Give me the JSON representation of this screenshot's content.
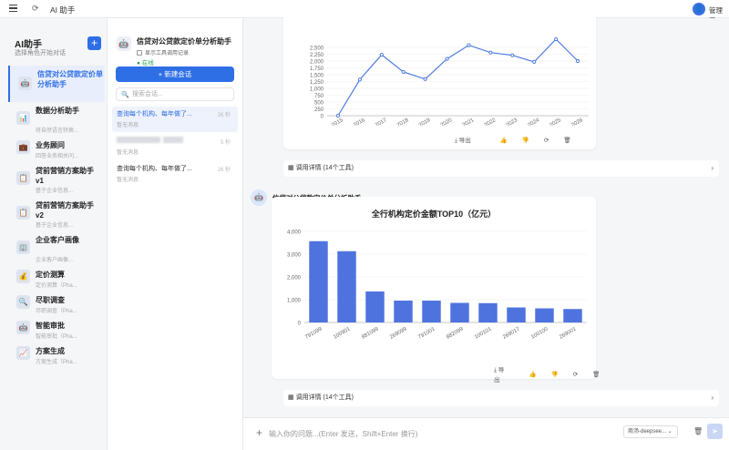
{
  "topbar": {
    "menu": "menu-icon",
    "refresh": "refresh-icon",
    "title": "AI 助手",
    "user": "管理员"
  },
  "sidebar": {
    "title": "AI助手",
    "subtitle": "选择角色开始对话",
    "add": "+",
    "agents": [
      {
        "name": "信贷对公贷款定价单分析助手",
        "desc": "",
        "icon": "robot-icon",
        "active": true
      },
      {
        "name": "数据分析助手",
        "desc": "将自然语言转换...",
        "icon": "chart-icon"
      },
      {
        "name": "业务顾问",
        "desc": "回答业务相关问...",
        "icon": "briefcase-icon"
      },
      {
        "name": "贷前营销方案助手v1",
        "desc": "基于企业信息...",
        "icon": "clipboard-icon"
      },
      {
        "name": "贷前营销方案助手v2",
        "desc": "基于企业信息...",
        "icon": "clipboard-icon"
      },
      {
        "name": "企业客户画像",
        "desc": "企业客户画像...",
        "icon": "building-icon"
      },
      {
        "name": "定价测算",
        "desc": "定价测算（Pha...",
        "icon": "moneybag-icon"
      },
      {
        "name": "尽职调查",
        "desc": "尽职调查（Pha...",
        "icon": "magnifier-icon"
      },
      {
        "name": "智能审批",
        "desc": "智能审批（Pha...",
        "icon": "robot-icon"
      },
      {
        "name": "方案生成",
        "desc": "方案生成（Pha...",
        "icon": "chart-up-icon"
      }
    ]
  },
  "convpanel": {
    "title": "信贷对公贷款定价单分析助手",
    "show_tool_log": "显示工具调用记录",
    "status": "● 在线",
    "new_button": "+ 新建会话",
    "search_placeholder": "搜索会话...",
    "items": [
      {
        "q": "查询每个机构、每年做了...",
        "t": "26 秒",
        "s": "暂无消息",
        "active": true
      },
      {
        "q": "",
        "t": "5 秒",
        "s": "暂无消息",
        "blurred": true
      },
      {
        "q": "查询每个机构、每年做了...",
        "t": "26 秒",
        "s": "暂无消息"
      }
    ]
  },
  "message": {
    "sender": "信贷对公贷款定价单分析助手",
    "actions": {
      "export": "导出",
      "like": "thumbs-up-icon",
      "dislike": "thumbs-down-icon",
      "retry": "refresh-icon",
      "delete": "trash-icon"
    },
    "tools_label": "调用详情 (14个工具)"
  },
  "input": {
    "placeholder": "输入你的问题...(Enter 发送，Shift+Enter 换行)",
    "model": "商汤-deepsee...",
    "delete": "trash-icon",
    "send": "send-icon"
  },
  "chart_data": [
    {
      "type": "line",
      "x": [
        "2015",
        "2016",
        "2017",
        "2018",
        "2019",
        "2020",
        "2021",
        "2022",
        "2023",
        "2024",
        "2025",
        "2026"
      ],
      "values": [
        0,
        1320,
        2230,
        1600,
        1340,
        2080,
        2580,
        2310,
        2210,
        1970,
        2800,
        2000
      ],
      "yticks": [
        "0",
        "250",
        "500",
        "750",
        "1,000",
        "1,250",
        "1,500",
        "1,750",
        "2,000",
        "2,250",
        "2,500"
      ],
      "ylim": [
        0,
        2500
      ],
      "color": "#4e7be0",
      "title": ""
    },
    {
      "type": "bar",
      "title": "全行机构定价金额TOP10（亿元）",
      "categories": [
        "791099",
        "100901",
        "881099",
        "269099",
        "791001",
        "882099",
        "100101",
        "269017",
        "100100",
        "269001"
      ],
      "values": [
        3570,
        3130,
        1360,
        960,
        960,
        860,
        850,
        660,
        620,
        590
      ],
      "yticks": [
        "0",
        "1,000",
        "2,000",
        "3,000",
        "4,000"
      ],
      "ylim": [
        0,
        4000
      ],
      "color": "#4e73df"
    }
  ]
}
